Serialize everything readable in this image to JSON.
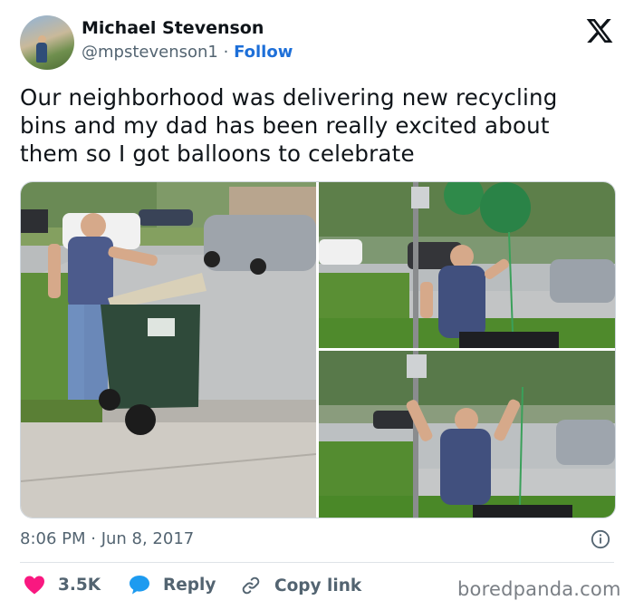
{
  "author": {
    "name": "Michael Stevenson",
    "handle": "@mpstevenson1",
    "separator": "·",
    "follow_label": "Follow"
  },
  "tweet": {
    "text": "Our neighborhood was delivering new recycling bins and my dad has been really excited about them so I got balloons to celebrate",
    "timestamp": "8:06 PM · Jun 8, 2017"
  },
  "actions": {
    "like_count": "3.5K",
    "reply_label": "Reply",
    "copy_link_label": "Copy link"
  },
  "watermark": "boredpanda.com",
  "icons": {
    "platform": "x-logo-icon",
    "info": "info-icon",
    "like": "heart-icon",
    "reply": "speech-bubble-icon",
    "copy": "link-icon"
  },
  "colors": {
    "like": "#f91880",
    "reply": "#1d9bf0",
    "follow": "#1d6fd8",
    "muted": "#536471"
  }
}
